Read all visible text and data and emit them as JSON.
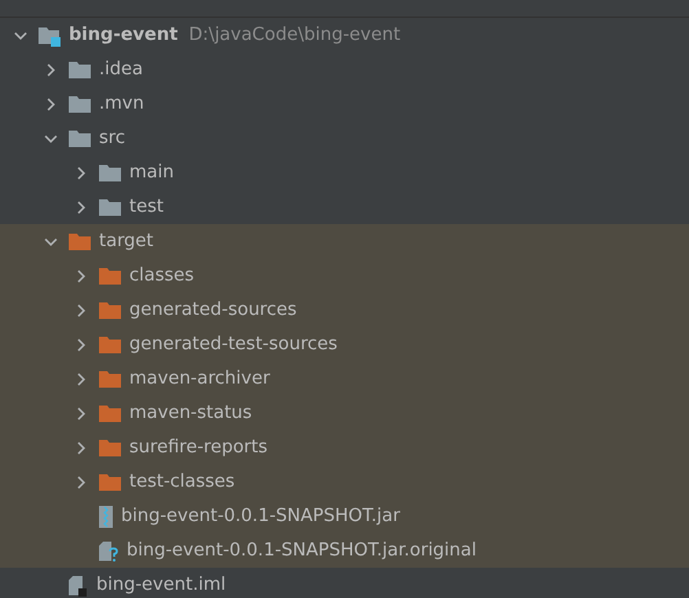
{
  "tree": [
    {
      "kind": "project",
      "name": "bing-event",
      "path": "D:\\javaCode\\bing-event",
      "expanded": true,
      "children": [
        {
          "kind": "folder",
          "name": ".idea",
          "expanded": false
        },
        {
          "kind": "folder",
          "name": ".mvn",
          "expanded": false
        },
        {
          "kind": "folder",
          "name": "src",
          "expanded": true,
          "children": [
            {
              "kind": "folder",
              "name": "main",
              "expanded": false
            },
            {
              "kind": "folder",
              "name": "test",
              "expanded": false
            }
          ]
        },
        {
          "kind": "folder",
          "name": "target",
          "expanded": true,
          "excluded": true,
          "children": [
            {
              "kind": "folder",
              "name": "classes",
              "expanded": false
            },
            {
              "kind": "folder",
              "name": "generated-sources",
              "expanded": false
            },
            {
              "kind": "folder",
              "name": "generated-test-sources",
              "expanded": false
            },
            {
              "kind": "folder",
              "name": "maven-archiver",
              "expanded": false
            },
            {
              "kind": "folder",
              "name": "maven-status",
              "expanded": false
            },
            {
              "kind": "folder",
              "name": "surefire-reports",
              "expanded": false
            },
            {
              "kind": "folder",
              "name": "test-classes",
              "expanded": false
            },
            {
              "kind": "jar",
              "name": "bing-event-0.0.1-SNAPSHOT.jar"
            },
            {
              "kind": "unknown",
              "name": "bing-event-0.0.1-SNAPSHOT.jar.original"
            }
          ]
        },
        {
          "kind": "iml",
          "name": "bing-event.iml"
        }
      ]
    }
  ]
}
